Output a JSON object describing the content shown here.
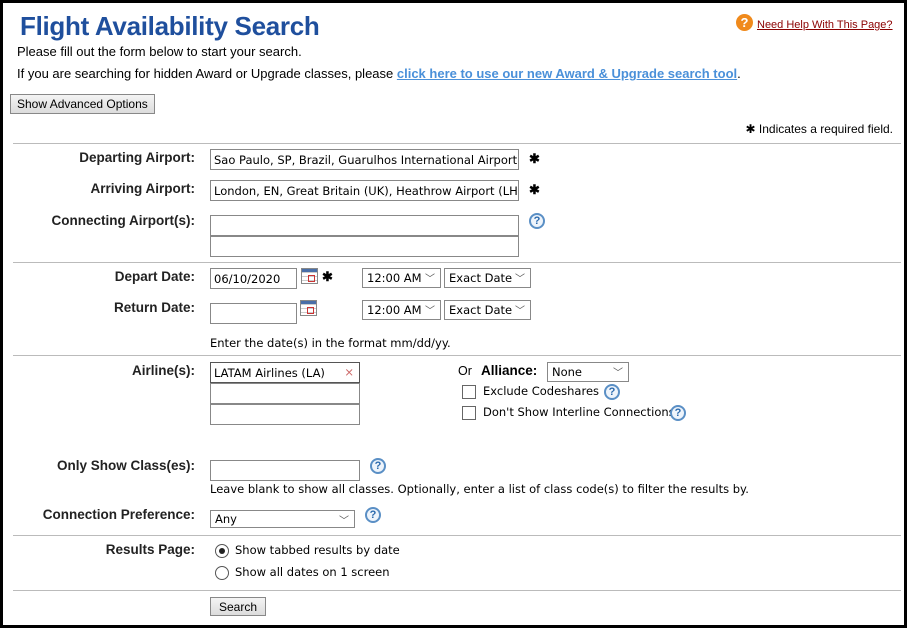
{
  "header": {
    "title": "Flight Availability Search",
    "help_link": "Need Help With This Page?",
    "intro": "Please fill out the form below to start your search.",
    "award_prefix": "If you are searching for hidden Award or Upgrade classes, please ",
    "award_link": "click here to use our new Award & Upgrade search tool",
    "award_suffix": ".",
    "advanced_button": "Show Advanced Options",
    "required_note": "Indicates a required field.",
    "required_symbol": "✱"
  },
  "airports": {
    "departing_label": "Departing Airport:",
    "departing_value": "Sao Paulo, SP, Brazil, Guarulhos International Airport (GRU)",
    "arriving_label": "Arriving Airport:",
    "arriving_value": "London, EN, Great Britain (UK), Heathrow Airport (LHR)",
    "connecting_label": "Connecting Airport(s):"
  },
  "dates": {
    "depart_label": "Depart Date:",
    "depart_value": "06/10/2020",
    "return_label": "Return Date:",
    "return_value": "",
    "depart_time": "12:00 AM",
    "depart_flex": "Exact Date",
    "return_time": "12:00 AM",
    "return_flex": "Exact Date",
    "format_hint": "Enter the date(s) in the format mm/dd/yy."
  },
  "airline": {
    "label": "Airline(s):",
    "value": "LATAM Airlines (LA)",
    "clear": "×",
    "or": "Or",
    "alliance_label": "Alliance:",
    "alliance_value": "None",
    "exclude_codeshares": "Exclude Codeshares",
    "no_interline": "Don't Show Interline Connections"
  },
  "classes": {
    "label": "Only Show Class(es):",
    "hint": "Leave blank to show all classes. Optionally, enter a list of class code(s) to filter the results by."
  },
  "connection": {
    "label": "Connection Preference:",
    "value": "Any"
  },
  "results": {
    "label": "Results Page:",
    "option1": "Show tabbed results by date",
    "option2": "Show all dates on 1 screen"
  },
  "search_button": "Search",
  "help_symbol": "?"
}
